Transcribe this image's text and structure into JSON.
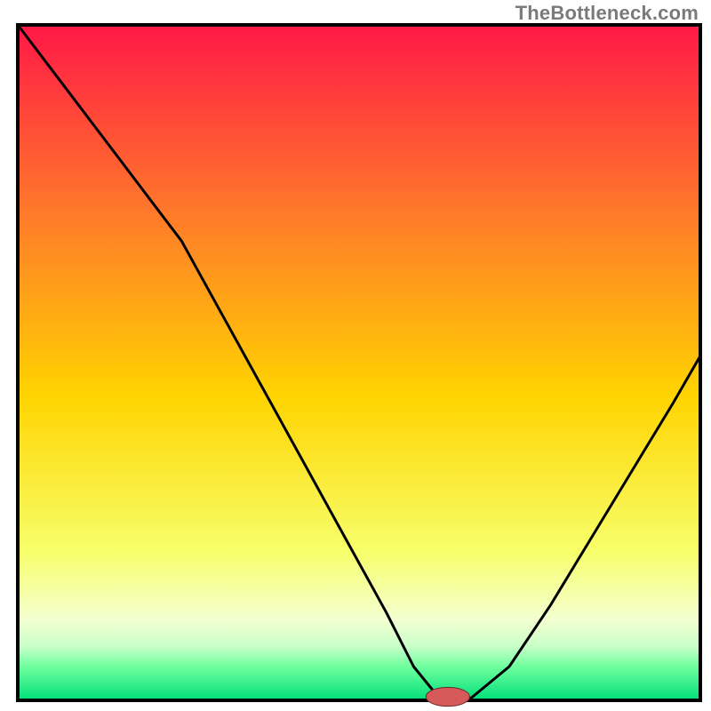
{
  "attribution": "TheBottleneck.com",
  "colors": {
    "gradient_top": "#ff1846",
    "gradient_mid_upper": "#ff7a2a",
    "gradient_mid": "#ffd400",
    "gradient_mid_lower": "#f7ff6b",
    "gradient_lower": "#f4ffd0",
    "gradient_green1": "#c9ffc9",
    "gradient_green2": "#6fff9e",
    "gradient_bottom": "#00e07a",
    "axis": "#000000",
    "curve": "#000000",
    "marker_fill": "#d65a5a",
    "marker_stroke": "#6a2b2b"
  },
  "chart_data": {
    "type": "line",
    "title": "",
    "xlabel": "",
    "ylabel": "",
    "xlim": [
      0,
      100
    ],
    "ylim": [
      0,
      100
    ],
    "x": [
      0,
      6,
      12,
      18,
      24,
      30,
      36,
      42,
      48,
      54,
      58,
      62,
      66,
      72,
      78,
      84,
      90,
      96,
      100
    ],
    "values": [
      100,
      92,
      84,
      76,
      68,
      57,
      46,
      35,
      24,
      13,
      5,
      0,
      0,
      5,
      14,
      24,
      34,
      44,
      51
    ],
    "marker": {
      "x": 63,
      "y": 0,
      "rx": 3.2,
      "ry": 1.4
    },
    "grid": false,
    "legend": false
  }
}
